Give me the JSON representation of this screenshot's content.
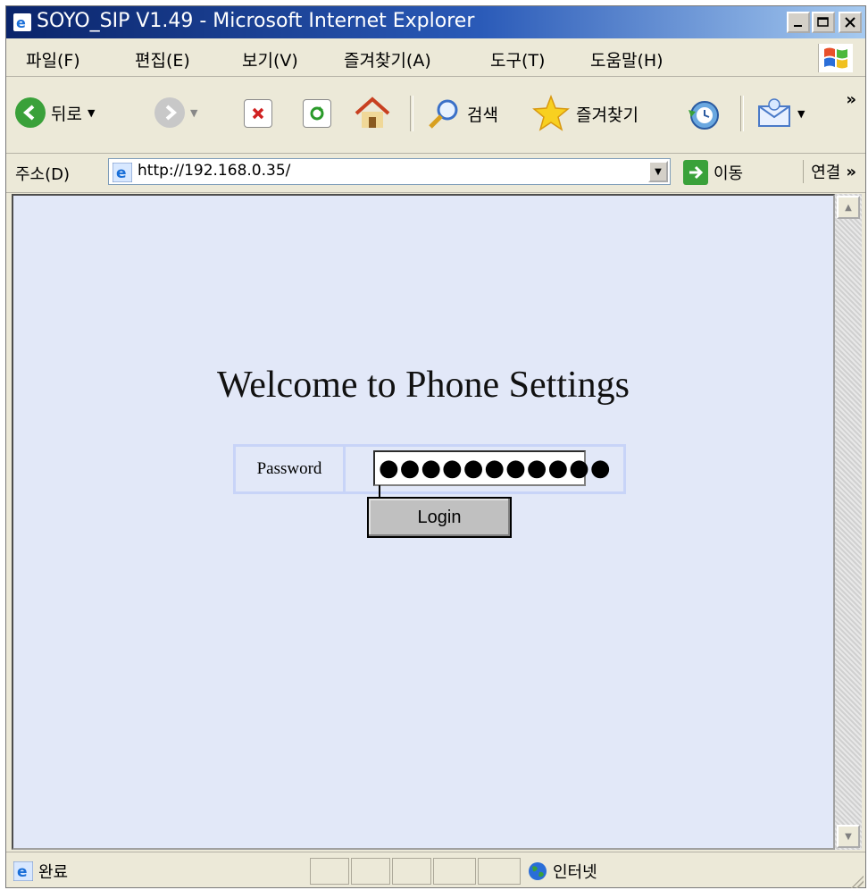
{
  "window": {
    "title": "SOYO_SIP V1.49 - Microsoft Internet Explorer",
    "controls": [
      "minimize",
      "maximize",
      "close"
    ]
  },
  "menubar": {
    "items": [
      "파일(F)",
      "편집(E)",
      "보기(V)",
      "즐겨찾기(A)",
      "도구(T)",
      "도움말(H)"
    ]
  },
  "toolbar": {
    "back_label": "뒤로",
    "search_label": "검색",
    "favorites_label": "즐겨찾기",
    "more": "»"
  },
  "addressbar": {
    "label": "주소(D)",
    "url": "http://192.168.0.35/",
    "go_label": "이동",
    "links_label": "연결",
    "more": "»"
  },
  "page": {
    "heading": "Welcome to Phone Settings",
    "password_label": "Password",
    "password_value": "●●●●●●●●●●●",
    "login_label": "Login"
  },
  "statusbar": {
    "status_text": "완료",
    "zone_text": "인터넷"
  },
  "colors": {
    "titlebar_start": "#0a246a",
    "content_bg": "#e2e8f8",
    "table_border": "#c8d4f8"
  }
}
